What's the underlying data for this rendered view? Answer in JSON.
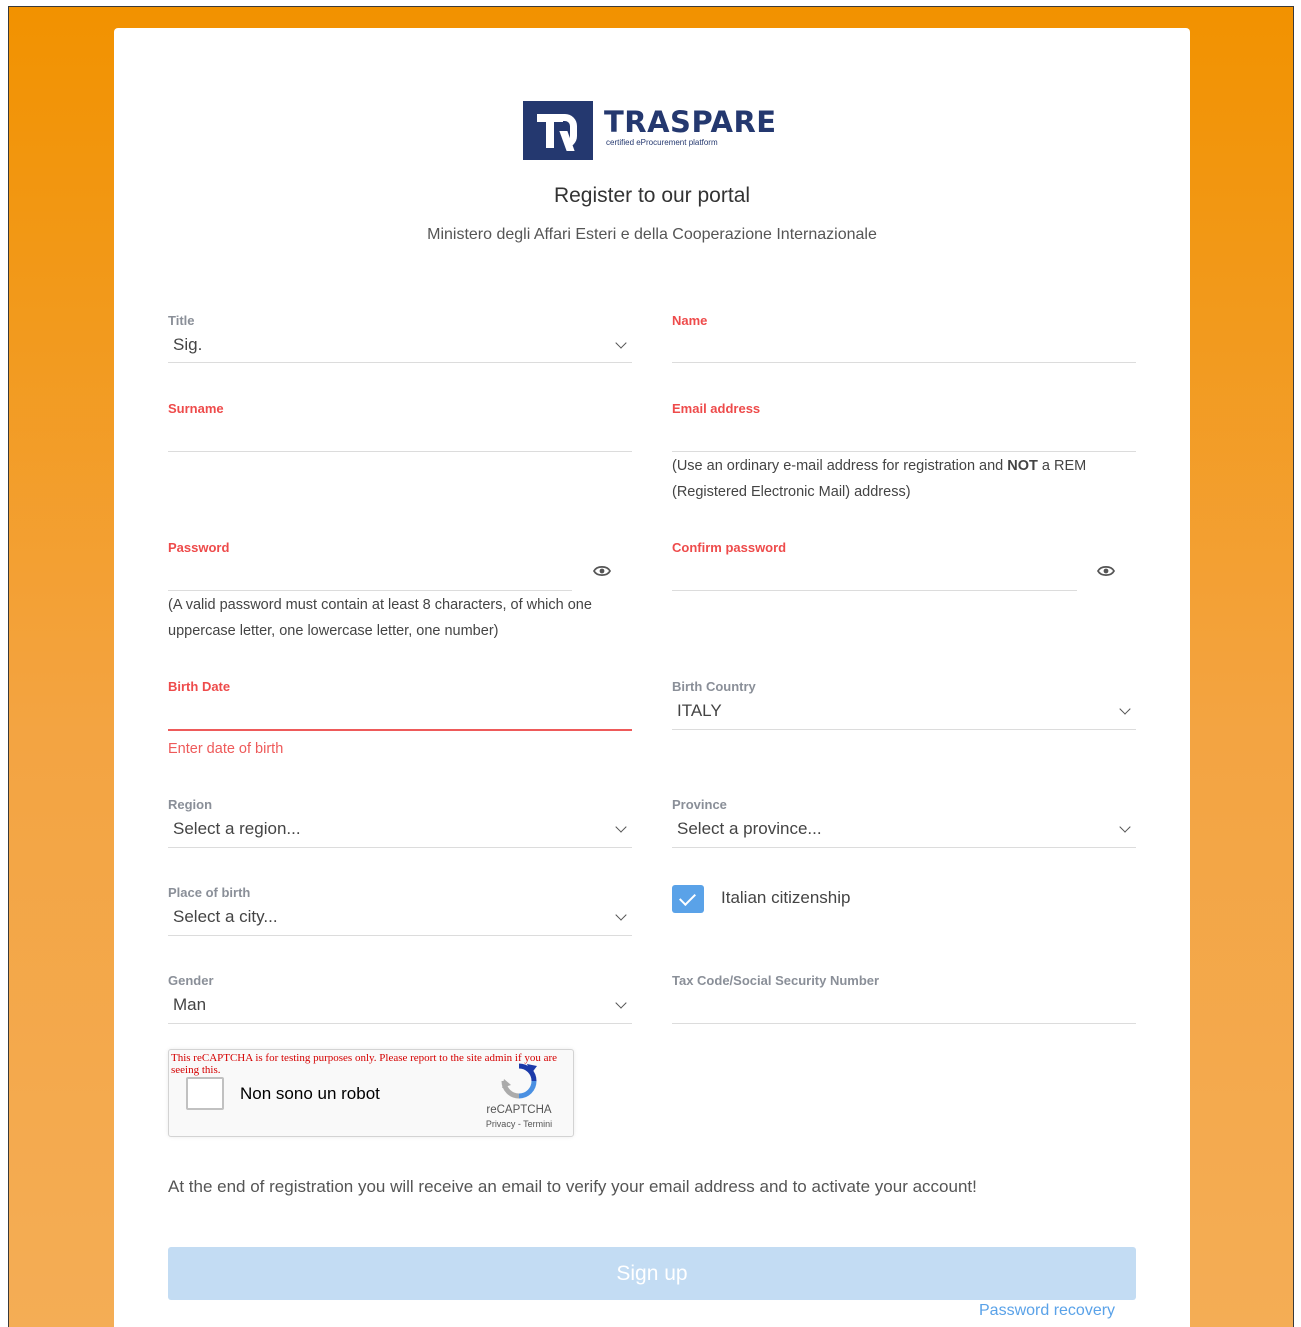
{
  "brand": {
    "name": "TRASPARE",
    "tagline": "certified eProcurement platform",
    "logo_icon": "traspare-logo-icon",
    "primary_color": "#24386f",
    "background_color": "#f29200"
  },
  "header": {
    "title": "Register to our portal",
    "subtitle": "Ministero degli Affari Esteri e della Cooperazione Internazionale"
  },
  "form": {
    "title_field": {
      "label": "Title",
      "value": "Sig."
    },
    "name_field": {
      "label": "Name",
      "value": ""
    },
    "surname_field": {
      "label": "Surname",
      "value": ""
    },
    "email_field": {
      "label": "Email address",
      "value": "",
      "hint_pre": "(Use an ordinary e-mail address for registration and ",
      "hint_bold": "NOT",
      "hint_post": " a REM",
      "hint_line2": "(Registered Electronic Mail) address)"
    },
    "password_field": {
      "label": "Password",
      "value": "",
      "hint_line1": "(A valid password must contain at least 8 characters, of which one",
      "hint_line2": "uppercase letter, one lowercase letter, one number)"
    },
    "confirm_password_field": {
      "label": "Confirm password",
      "value": ""
    },
    "birth_date_field": {
      "label": "Birth Date",
      "value": "",
      "error": "Enter date of birth"
    },
    "birth_country_field": {
      "label": "Birth Country",
      "value": "ITALY"
    },
    "region_field": {
      "label": "Region",
      "value": "Select a region..."
    },
    "province_field": {
      "label": "Province",
      "value": "Select a province..."
    },
    "place_of_birth_field": {
      "label": "Place of birth",
      "value": "Select a city..."
    },
    "citizenship_checkbox": {
      "label": "Italian citizenship",
      "checked": true
    },
    "gender_field": {
      "label": "Gender",
      "value": "Man"
    },
    "tax_code_field": {
      "label": "Tax Code/Social Security Number",
      "value": ""
    }
  },
  "captcha": {
    "warning": "This reCAPTCHA is for testing purposes only. Please report to the site admin if you are seeing this.",
    "label": "Non sono un robot",
    "brand": "reCAPTCHA",
    "links": "Privacy - Termini"
  },
  "notice": "At the end of registration you will receive an email to verify your email address and to activate your account!",
  "actions": {
    "signup_label": "Sign up",
    "recovery_label": "Password recovery"
  },
  "colors": {
    "required_label": "#ee4b4b",
    "accent_blue": "#5aa2e8",
    "signup_disabled": "#c3dcf3"
  }
}
